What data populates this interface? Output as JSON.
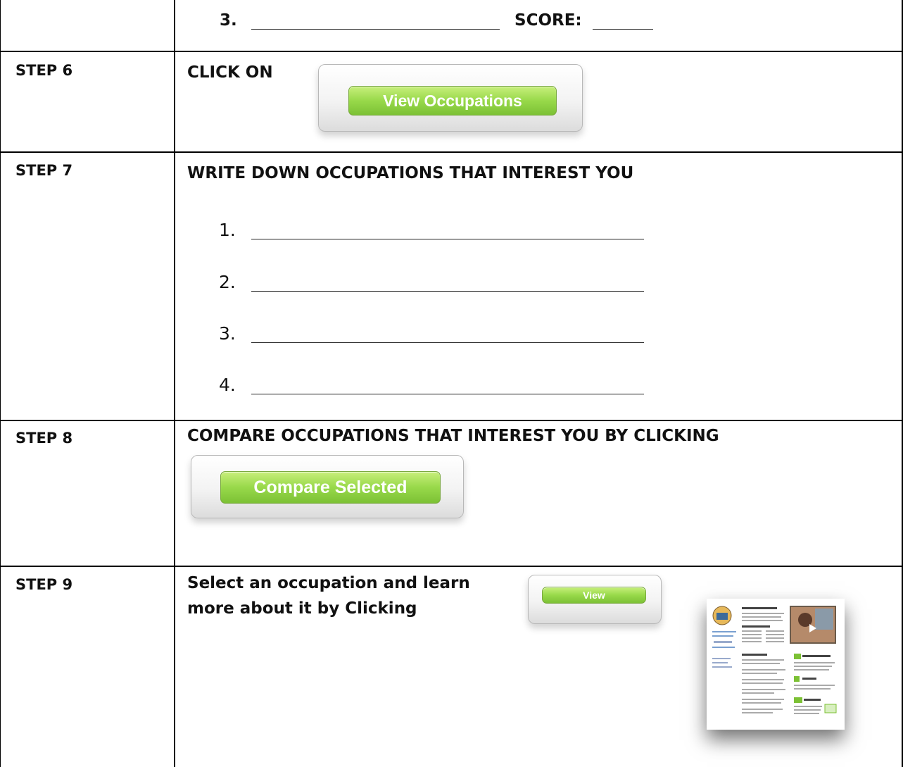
{
  "row0": {
    "number": "3.",
    "blank": "_______________________",
    "score_label": "SCORE:",
    "score_blank": "______"
  },
  "step6": {
    "label": "STEP 6",
    "text": "CLICK ON",
    "button": "View Occupations"
  },
  "step7": {
    "label": "STEP 7",
    "text": "WRITE DOWN OCCUPATIONS THAT INTEREST YOU",
    "items": [
      "1.",
      "2.",
      "3.",
      "4."
    ]
  },
  "step8": {
    "label": "STEP 8",
    "text": "COMPARE OCCUPATIONS THAT INTEREST YOU BY CLICKING",
    "button": "Compare Selected"
  },
  "step9": {
    "label": "STEP 9",
    "text_line1": "Select an occupation and learn",
    "text_line2": "more about it by Clicking",
    "button": "View"
  },
  "colors": {
    "button_green": "#98d94a",
    "border": "#000000"
  }
}
